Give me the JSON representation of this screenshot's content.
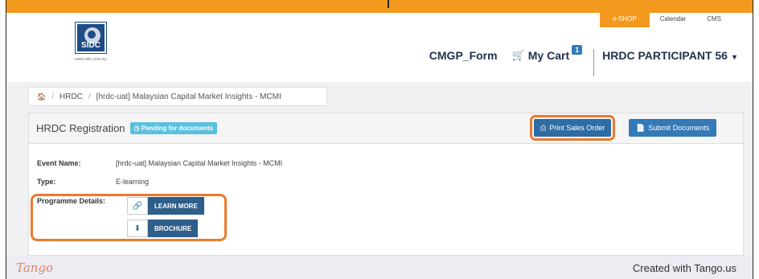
{
  "utility_nav": {
    "eshop": "e-SHOP",
    "calendar": "Calendar",
    "cms": "CMS"
  },
  "logo": {
    "text": "SIDC",
    "url": "www.sidc.com.my"
  },
  "main_nav": {
    "form": "CMGP_Form",
    "cart_label": "My Cart",
    "cart_count": "1",
    "user": "HRDC PARTICIPANT 56"
  },
  "icons": {
    "cart": "shopping-cart-icon",
    "home": "home-icon",
    "status": "clock-icon",
    "print": "printer-icon",
    "submit": "file-icon",
    "link": "link-icon",
    "download": "download-icon"
  },
  "breadcrumb": {
    "items": [
      "HRDC",
      "[hrdc-uat] Malaysian Capital Market Insights - MCMI"
    ]
  },
  "panel": {
    "title": "HRDC Registration",
    "status": "Pending for documents",
    "print_button": "Print Sales Order",
    "submit_button": "Submit Documents"
  },
  "details": {
    "event_name_label": "Event Name:",
    "event_name_value": "[hrdc-uat] Malaysian Capital Market Insights - MCMI",
    "type_label": "Type:",
    "type_value": "E-learning",
    "programme_label": "Programme Details:",
    "learn_more": "LEARN MORE",
    "brochure": "BROCHURE"
  },
  "footer": {
    "logo": "Tango",
    "credit": "Created with Tango.us"
  },
  "colors": {
    "accent_orange": "#f39a1e",
    "highlight_orange": "#ec7a2e",
    "primary_blue": "#337ab7",
    "status_teal": "#5bc0de"
  }
}
